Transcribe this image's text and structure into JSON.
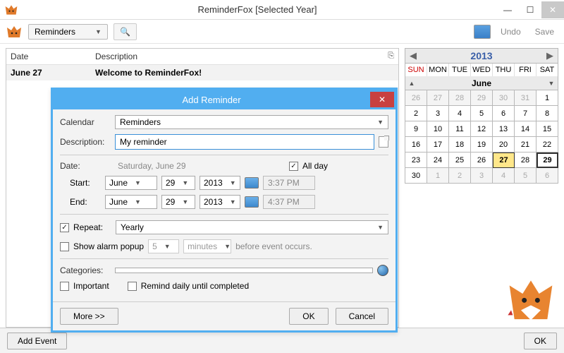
{
  "window": {
    "title": "ReminderFox [Selected Year]"
  },
  "toolbar": {
    "view_dropdown": "Reminders",
    "undo": "Undo",
    "save": "Save"
  },
  "list": {
    "col_date": "Date",
    "col_desc": "Description",
    "rows": [
      {
        "date": "June 27",
        "desc": "Welcome to ReminderFox!"
      }
    ]
  },
  "calendar": {
    "year": "2013",
    "dow": [
      "SUN",
      "MON",
      "TUE",
      "WED",
      "THU",
      "FRI",
      "SAT"
    ],
    "month": "June",
    "cells": [
      {
        "n": "26",
        "o": true
      },
      {
        "n": "27",
        "o": true
      },
      {
        "n": "28",
        "o": true
      },
      {
        "n": "29",
        "o": true
      },
      {
        "n": "30",
        "o": true
      },
      {
        "n": "31",
        "o": true
      },
      {
        "n": "1"
      },
      {
        "n": "2"
      },
      {
        "n": "3"
      },
      {
        "n": "4"
      },
      {
        "n": "5"
      },
      {
        "n": "6"
      },
      {
        "n": "7"
      },
      {
        "n": "8"
      },
      {
        "n": "9"
      },
      {
        "n": "10"
      },
      {
        "n": "11"
      },
      {
        "n": "12"
      },
      {
        "n": "13"
      },
      {
        "n": "14"
      },
      {
        "n": "15"
      },
      {
        "n": "16"
      },
      {
        "n": "17"
      },
      {
        "n": "18"
      },
      {
        "n": "19"
      },
      {
        "n": "20"
      },
      {
        "n": "21"
      },
      {
        "n": "22"
      },
      {
        "n": "23"
      },
      {
        "n": "24"
      },
      {
        "n": "25"
      },
      {
        "n": "26"
      },
      {
        "n": "27",
        "today": true
      },
      {
        "n": "28"
      },
      {
        "n": "29",
        "sel": true
      },
      {
        "n": "30"
      },
      {
        "n": "1",
        "o": true
      },
      {
        "n": "2",
        "o": true
      },
      {
        "n": "3",
        "o": true
      },
      {
        "n": "4",
        "o": true
      },
      {
        "n": "5",
        "o": true
      },
      {
        "n": "6",
        "o": true
      }
    ]
  },
  "bottom": {
    "add_event": "Add Event",
    "ok": "OK"
  },
  "dialog": {
    "title": "Add Reminder",
    "calendar_label": "Calendar",
    "calendar_value": "Reminders",
    "description_label": "Description:",
    "description_value": "My reminder",
    "date_label": "Date:",
    "date_readable": "Saturday, June 29",
    "allday_label": "All day",
    "start_label": "Start:",
    "end_label": "End:",
    "month_start": "June",
    "day_start": "29",
    "year_start": "2013",
    "time_start": "3:37 PM",
    "month_end": "June",
    "day_end": "29",
    "year_end": "2013",
    "time_end": "4:37 PM",
    "repeat_label": "Repeat:",
    "repeat_value": "Yearly",
    "alarm_label": "Show alarm popup",
    "alarm_value": "5",
    "alarm_unit": "minutes",
    "alarm_tail": "before event occurs.",
    "categories_label": "Categories:",
    "important_label": "Important",
    "remind_daily_label": "Remind daily until completed",
    "more": "More >>",
    "ok": "OK",
    "cancel": "Cancel"
  }
}
